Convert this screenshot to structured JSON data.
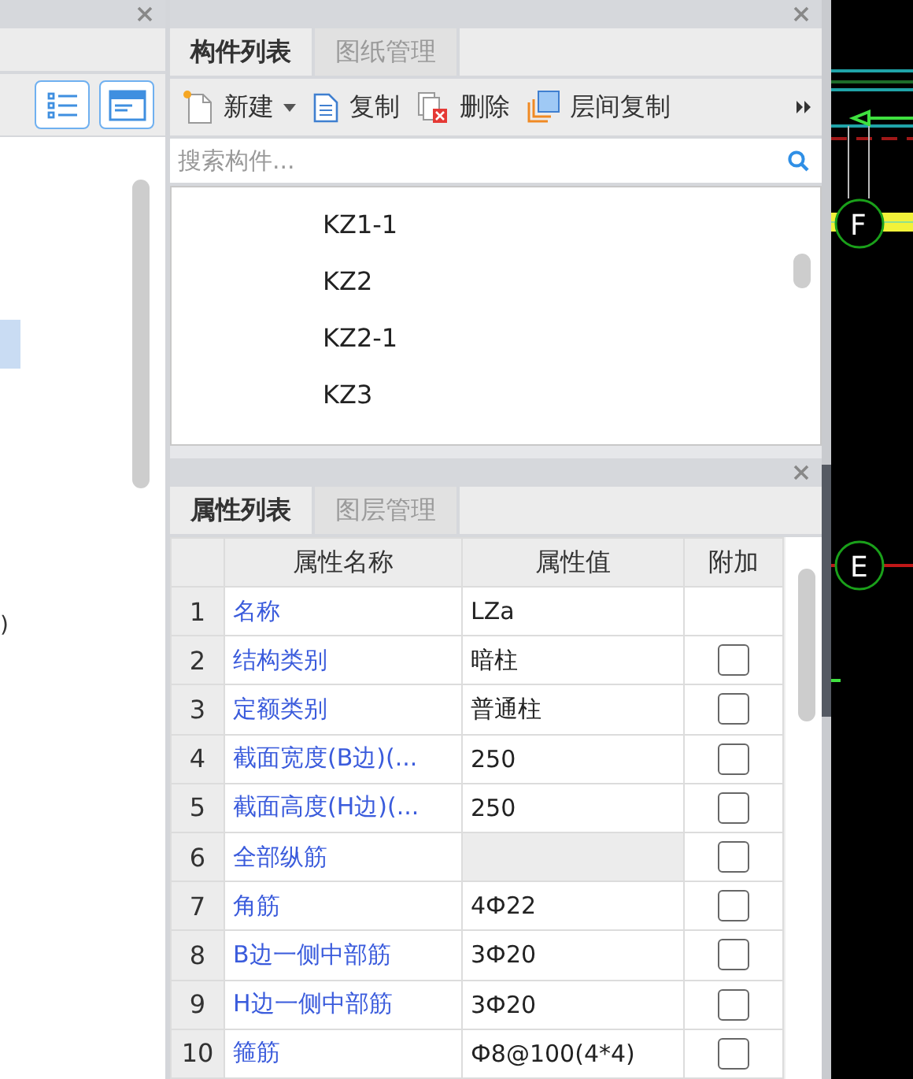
{
  "left_panel": {
    "tree_fragment": ")"
  },
  "component_panel": {
    "tabs": [
      {
        "label": "构件列表",
        "selected": true
      },
      {
        "label": "图纸管理",
        "selected": false
      }
    ],
    "toolbar": [
      {
        "kind": "new",
        "label": "新建"
      },
      {
        "kind": "copy",
        "label": "复制"
      },
      {
        "kind": "delete",
        "label": "删除"
      },
      {
        "kind": "floor_copy",
        "label": "层间复制"
      }
    ],
    "search": {
      "placeholder": "搜索构件..."
    },
    "items": [
      "KZ1-1",
      "KZ2",
      "KZ2-1",
      "KZ3"
    ]
  },
  "property_panel": {
    "tabs": [
      {
        "label": "属性列表",
        "selected": true
      },
      {
        "label": "图层管理",
        "selected": false
      }
    ],
    "columns": [
      "属性名称",
      "属性值",
      "附加"
    ],
    "rows": [
      {
        "index": "1",
        "name": "名称",
        "value": "LZa"
      },
      {
        "index": "2",
        "name": "结构类别",
        "value": "暗柱",
        "checked": false
      },
      {
        "index": "3",
        "name": "定额类别",
        "value": "普通柱",
        "checked": false
      },
      {
        "index": "4",
        "name": "截面宽度(B边)(...",
        "value": "250",
        "checked": false
      },
      {
        "index": "5",
        "name": "截面高度(H边)(...",
        "value": "250",
        "checked": false
      },
      {
        "index": "6",
        "name": "全部纵筋",
        "checked": false
      },
      {
        "index": "7",
        "name": "角筋",
        "value": "4Ф22",
        "checked": false
      },
      {
        "index": "8",
        "name": "B边一侧中部筋",
        "value": "3Ф20",
        "checked": false
      },
      {
        "index": "9",
        "name": "H边一侧中部筋",
        "value": "3Ф20",
        "checked": false
      },
      {
        "index": "10",
        "name": "箍筋",
        "value": "Ф8@100(4*4)",
        "checked": false
      }
    ]
  },
  "canvas": {
    "axis_labels": [
      "F",
      "E"
    ]
  }
}
